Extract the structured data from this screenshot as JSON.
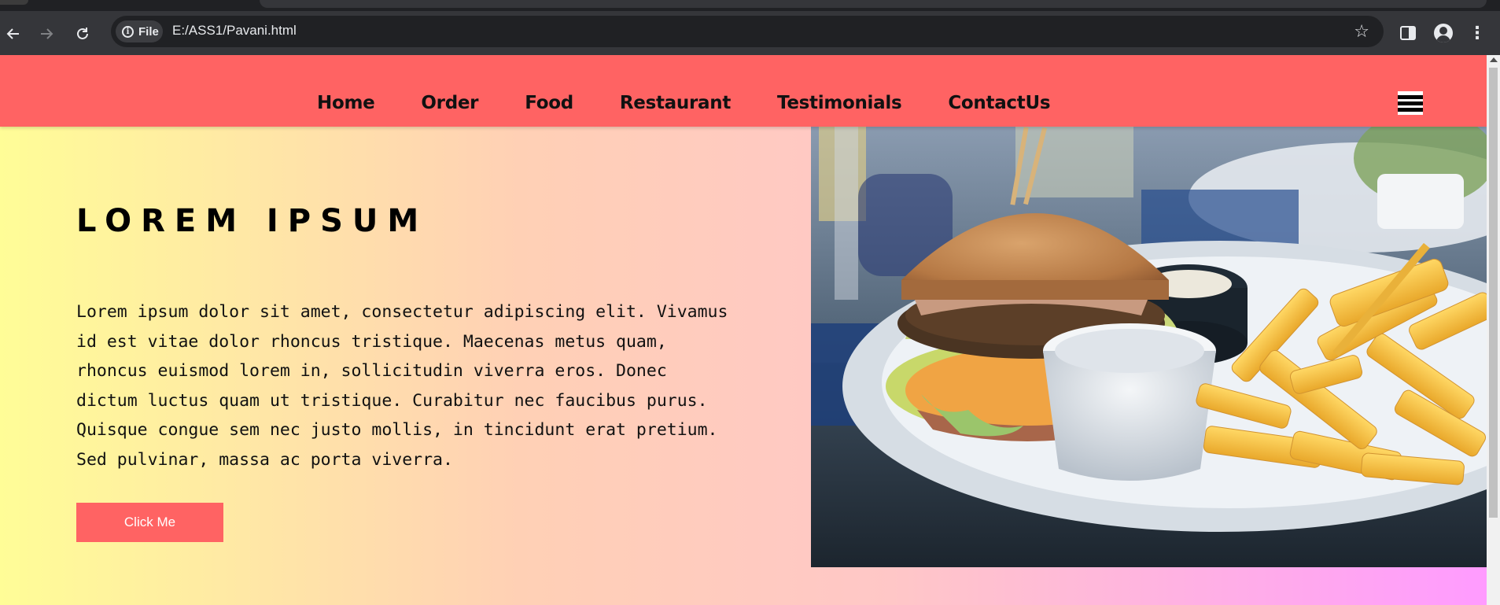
{
  "browser": {
    "back_icon": "arrow-left-icon",
    "forward_icon": "arrow-right-icon",
    "reload_icon": "reload-icon",
    "chip_label": "File",
    "url": "E:/ASS1/Pavani.html"
  },
  "nav": {
    "items": [
      {
        "label": "Home"
      },
      {
        "label": "Order"
      },
      {
        "label": "Food"
      },
      {
        "label": "Restaurant"
      },
      {
        "label": "Testimonials"
      },
      {
        "label": "ContactUs"
      }
    ]
  },
  "hero": {
    "title": "LOREM IPSUM",
    "body_lines": [
      "Lorem ipsum dolor sit amet, consectetur adipiscing elit. Vivamus",
      "id est vitae dolor rhoncus tristique. Maecenas metus quam,",
      "rhoncus euismod lorem in, sollicitudin viverra eros. Donec",
      "dictum luctus quam ut tristique. Curabitur nec faucibus purus.",
      "Quisque congue sem nec justo mollis, in tincidunt erat pretium.",
      "Sed pulvinar, massa ac porta viverra."
    ],
    "button_label": "Click Me"
  },
  "colors": {
    "nav_bg": "#ff6363",
    "button_bg": "#ff6363",
    "gradient_start": "#fffd97",
    "gradient_end": "#ff9bff"
  }
}
